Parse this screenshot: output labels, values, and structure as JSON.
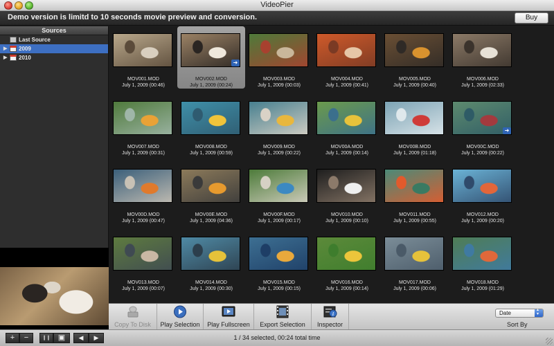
{
  "window": {
    "title": "VideoPier"
  },
  "banner": {
    "text": "Demo version is limitd to 10 seconds movie preview and conversion.",
    "buy_label": "Buy"
  },
  "sidebar": {
    "header": "Sources",
    "items": [
      {
        "label": "Last Source",
        "icon": "last-source-icon"
      },
      {
        "label": "2009",
        "icon": "calendar-icon",
        "selected": true
      },
      {
        "label": "2010",
        "icon": "calendar-icon"
      }
    ]
  },
  "clips": [
    {
      "name": "MOV001.MOD",
      "date": "July 1, 2009 (00:46)",
      "colors": [
        "#b9a88b",
        "#d9cfbf",
        "#5b4b3a"
      ]
    },
    {
      "name": "MOV002.MOD",
      "date": "July 1, 2009 (00:24)",
      "colors": [
        "#9b8265",
        "#efe8dc",
        "#2a2522"
      ],
      "selected": true
    },
    {
      "name": "MOV003.MOD",
      "date": "July 1, 2009 (00:03)",
      "colors": [
        "#4e7a3a",
        "#c9b79b",
        "#a8412f"
      ]
    },
    {
      "name": "MOV004.MOD",
      "date": "July 1, 2009 (00:41)",
      "colors": [
        "#cf5a2a",
        "#e6c6a7",
        "#7a3a24"
      ]
    },
    {
      "name": "MOV005.MOD",
      "date": "July 1, 2009 (00:40)",
      "colors": [
        "#6a4f34",
        "#d9922e",
        "#2f2a26"
      ]
    },
    {
      "name": "MOV006.MOD",
      "date": "July 1, 2009 (02:33)",
      "colors": [
        "#8c7a67",
        "#e7e1d6",
        "#3b332c"
      ]
    },
    {
      "name": "MOV007.MOD",
      "date": "July 1, 2009 (00:31)",
      "colors": [
        "#4f7a3c",
        "#e9a236",
        "#9fb6a8"
      ]
    },
    {
      "name": "MOV008.MOD",
      "date": "July 1, 2009 (00:59)",
      "colors": [
        "#3f8fa8",
        "#f0c43a",
        "#2f5b70"
      ]
    },
    {
      "name": "MOV009.MOD",
      "date": "July 1, 2009 (00:22)",
      "colors": [
        "#477f8f",
        "#e9b73d",
        "#d9d2c6"
      ]
    },
    {
      "name": "MOV00A.MOD",
      "date": "July 1, 2009 (00:14)",
      "colors": [
        "#6b9a4c",
        "#e8c23b",
        "#3b6f8c"
      ]
    },
    {
      "name": "MOV00B.MOD",
      "date": "July 1, 2009 (01:18)",
      "colors": [
        "#7ca3b4",
        "#cf3b38",
        "#dfe8ec"
      ]
    },
    {
      "name": "MOV00C.MOD",
      "date": "July 1, 2009 (00:22)",
      "colors": [
        "#5d8a6e",
        "#a33a3e",
        "#2e5b66"
      ]
    },
    {
      "name": "MOV00D.MOD",
      "date": "July 1, 2009 (00:47)",
      "colors": [
        "#3b5f7a",
        "#e07a2c",
        "#c8c1b5"
      ]
    },
    {
      "name": "MOV00E.MOD",
      "date": "July 1, 2009 (04:36)",
      "colors": [
        "#8c7a5a",
        "#e79a2e",
        "#3a3a3a"
      ]
    },
    {
      "name": "MOV00F.MOD",
      "date": "July 1, 2009 (00:17)",
      "colors": [
        "#4d7b3a",
        "#3c89c2",
        "#d6d1c4"
      ]
    },
    {
      "name": "MOV010.MOD",
      "date": "July 1, 2009 (00:10)",
      "colors": [
        "#1e1e1e",
        "#efefef",
        "#8c7a6a"
      ]
    },
    {
      "name": "MOV011.MOD",
      "date": "July 1, 2009 (00:55)",
      "colors": [
        "#4b8a78",
        "#3a7a62",
        "#e25a2c"
      ]
    },
    {
      "name": "MOV012.MOD",
      "date": "July 1, 2009 (00:20)",
      "colors": [
        "#6bb3d6",
        "#e2663a",
        "#2f4a6b"
      ]
    },
    {
      "name": "MOV013.MOD",
      "date": "July 1, 2009 (00:07)",
      "colors": [
        "#5e7b3f",
        "#c9b8a4",
        "#3f4a52"
      ]
    },
    {
      "name": "MOV014.MOD",
      "date": "July 1, 2009 (00:30)",
      "colors": [
        "#4f8aa5",
        "#e6c23a",
        "#2c3e4c"
      ]
    },
    {
      "name": "MOV015.MOD",
      "date": "July 1, 2009 (00:15)",
      "colors": [
        "#3d6f92",
        "#e9a93c",
        "#1e3e66"
      ]
    },
    {
      "name": "MOV016.MOD",
      "date": "July 1, 2009 (00:14)",
      "colors": [
        "#5c8a3a",
        "#ecc53b",
        "#3e7d2d"
      ]
    },
    {
      "name": "MOV017.MOD",
      "date": "July 1, 2009 (00:06)",
      "colors": [
        "#7b8d98",
        "#e6c23b",
        "#4a5a68"
      ]
    },
    {
      "name": "MOV018.MOD",
      "date": "July 1, 2009 (01:29)",
      "colors": [
        "#4f7d55",
        "#e0683a",
        "#3f7aa2"
      ]
    }
  ],
  "toolbar": {
    "items": [
      {
        "label": "Copy To Disk",
        "icon": "copy-to-disk-icon",
        "enabled": false
      },
      {
        "label": "Play Selection",
        "icon": "play-selection-icon",
        "enabled": true
      },
      {
        "label": "Play Fullscreen",
        "icon": "play-fullscreen-icon",
        "enabled": true
      },
      {
        "label": "Export Selection",
        "icon": "export-selection-icon",
        "enabled": true
      },
      {
        "label": "Inspector",
        "icon": "inspector-icon",
        "enabled": true
      }
    ],
    "sort_value": "Date",
    "sort_label": "Sort By"
  },
  "statusbar": {
    "text": "1 / 34 selected, 00:24 total time",
    "buttons": [
      {
        "name": "add-button",
        "glyph": "+"
      },
      {
        "name": "remove-button",
        "glyph": "−"
      },
      {
        "name": "pause-button",
        "glyph": "❙❙"
      },
      {
        "name": "fullscreen-button",
        "glyph": "▣"
      },
      {
        "name": "prev-button",
        "glyph": "◀"
      },
      {
        "name": "next-button",
        "glyph": "▶"
      }
    ]
  },
  "accent": "#3d6fc2"
}
